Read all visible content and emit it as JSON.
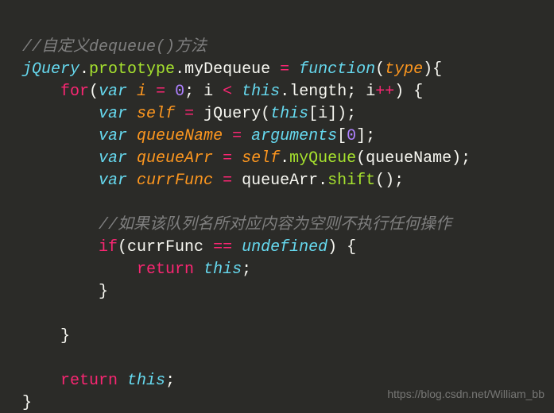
{
  "code": {
    "comment_top": "//自定义dequeue()方法",
    "jquery": "jQuery",
    "dot1": ".",
    "prototype": "prototype",
    "dot2": ".",
    "mydequeue": "myDequeue",
    "assign1": " = ",
    "function": "function",
    "paren_open1": "(",
    "param_type": "type",
    "paren_close_brace1": "){",
    "for": "for",
    "for_open": "(",
    "var1": "var",
    "sp1": " ",
    "i_decl": "i",
    "eq1": " = ",
    "zero": "0",
    "semi1": "; ",
    "i_ref1": "i",
    "lt": " < ",
    "this1": "this",
    "dot3": ".",
    "length": "length",
    "semi2": "; ",
    "i_ref2": "i",
    "inc": "++",
    "for_close": ") {",
    "var2": "var",
    "sp2": " ",
    "self_decl": "self",
    "eq2": " = ",
    "jquery2": "jQuery",
    "paren_open2": "(",
    "this2": "this",
    "bracket_open1": "[",
    "i_ref3": "i",
    "bracket_close_paren_semi": "]);",
    "var3": "var",
    "sp3": " ",
    "queuename_decl": "queueName",
    "eq3": " = ",
    "arguments": "arguments",
    "bracket_open2": "[",
    "zero2": "0",
    "bracket_close_semi2": "];",
    "var4": "var",
    "sp4": " ",
    "queuearr_decl": "queueArr",
    "eq4": " = ",
    "self_ref": "self",
    "dot4": ".",
    "myqueue": "myQueue",
    "paren_open3": "(",
    "queuename_ref": "queueName",
    "paren_close_semi3": ");",
    "var5": "var",
    "sp5": " ",
    "currfunc_decl": "currFunc",
    "eq5": " = ",
    "queuearr_ref": "queueArr",
    "dot5": ".",
    "shift": "shift",
    "parens_semi": "();",
    "comment_inner": "//如果该队列名所对应内容为空则不执行任何操作",
    "if": "if",
    "if_open": "(",
    "currfunc_ref": "currFunc",
    "eqeq": " == ",
    "undefined": "undefined",
    "if_close": ") {",
    "return1": "return",
    "sp_ret1": " ",
    "this3": "this",
    "semi_ret1": ";",
    "brace_close_if": "}",
    "brace_close_for": "}",
    "return2": "return",
    "sp_ret2": " ",
    "this4": "this",
    "semi_ret2": ";",
    "brace_close_fn": "}"
  },
  "watermark": "https://blog.csdn.net/William_bb"
}
